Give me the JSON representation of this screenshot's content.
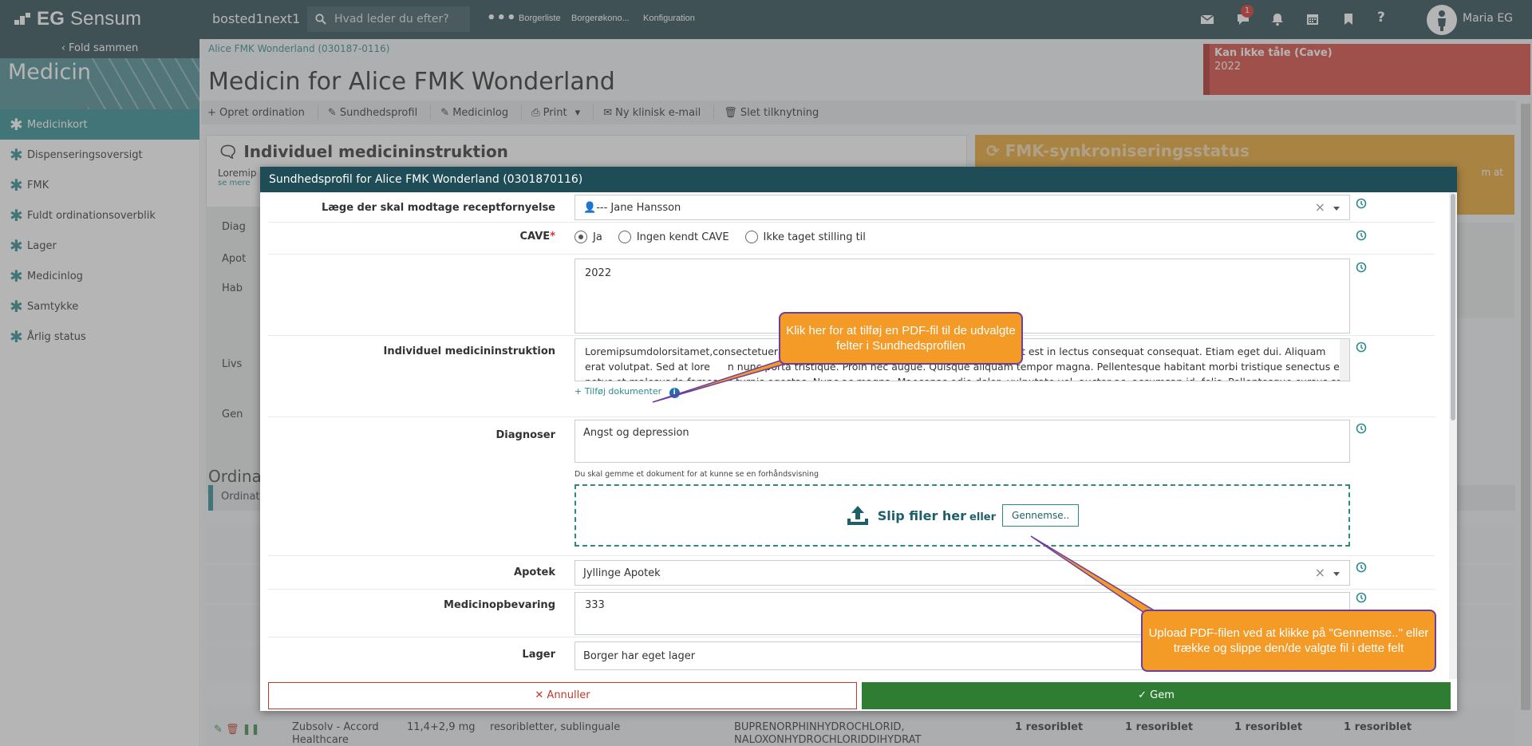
{
  "app": {
    "logo_prefix": "EG",
    "logo_suffix": "Sensum",
    "site": "bosted1next1"
  },
  "search": {
    "placeholder": "Hvad leder du efter?"
  },
  "topnav": [
    "Borgerliste",
    "Borgerøkono...",
    "Konfiguration"
  ],
  "notifications": {
    "count": "1"
  },
  "user": {
    "name": "Maria EG"
  },
  "sidebar": {
    "fold_label": "Fold sammen",
    "title": "Medicin",
    "items": [
      {
        "label": "Medicinkort",
        "active": true
      },
      {
        "label": "Dispenseringsoversigt"
      },
      {
        "label": "FMK"
      },
      {
        "label": "Fuldt ordinationsoverblik"
      },
      {
        "label": "Lager"
      },
      {
        "label": "Medicinlog"
      },
      {
        "label": "Samtykke"
      },
      {
        "label": "Årlig status"
      }
    ]
  },
  "page": {
    "breadcrumb": "Alice FMK Wonderland (030187-0116)",
    "title": "Medicin for Alice FMK Wonderland",
    "cave_banner": {
      "title": "Kan ikke tåle (Cave)",
      "text": "2022"
    }
  },
  "toolbar": [
    "Opret ordination",
    "Sundhedsprofil",
    "Medicinlog",
    "Print",
    "Ny klinisk e-mail",
    "Slet tilknytning"
  ],
  "cards": {
    "left_title": "Individuel medicininstruktion",
    "left_text": "Loremip",
    "left_more": "se mere",
    "right_title": "FMK-synkroniseringsstatus",
    "right_text": "m at"
  },
  "background_labels": [
    "Diag",
    "Apot",
    "Hab",
    "Livs",
    "Gen"
  ],
  "orders": {
    "title": "Ordinat",
    "tab": "Ordinat",
    "last_row": {
      "name": "Zubsolv - Accord Healthcare",
      "dose": "11,4+2,9 mg",
      "form": "resoribletter, sublinguale",
      "substance": "BUPRENORPHINHYDROCHLORID, NALOXONHYDROCHLORIDDIHYDRAT",
      "qty": [
        "1 resoriblet",
        "1 resoriblet",
        "1 resoriblet",
        "1 resoriblet"
      ]
    }
  },
  "modal": {
    "title": "Sundhedsprofil for Alice FMK Wonderland (0301870116)",
    "doctor": {
      "label": "Læge der skal modtage receptfornyelse",
      "value": "--- Jane Hansson"
    },
    "cave": {
      "label": "CAVE",
      "required": "*",
      "options": [
        "Ja",
        "Ingen kendt CAVE",
        "Ikke taget stilling til"
      ],
      "selected": "Ja",
      "text": "2022"
    },
    "instruction": {
      "label": "Individuel medicininstruktion",
      "line1": "Loremipsumdolorsitamet,consectetueradip",
      "line1b": "ut est in lectus consequat consequat. Etiam eget dui. Aliquam",
      "line2a": "erat volutpat. Sed at lore",
      "line2b": "n nunc porta tristique. Proin nec augue. Quisque aliquam tempor magna. Pellentesque habitant morbi tristique senectus et",
      "line3": "netus et malesuada fames ac turpis egestas. Nunc ac magna. Maecenas odio dolor, vulputate vel, auctor ac, accumsan id, felis. Pellentesque cursus sagittis",
      "add_doc": "Tilføj dokumenter"
    },
    "diagnoses": {
      "label": "Diagnoser",
      "value": "Angst og depression",
      "hint": "Du skal gemme et dokument for at kunne se en forhåndsvisning"
    },
    "dropzone": {
      "text": "Slip filer her",
      "or": "eller",
      "browse": "Gennemse.."
    },
    "pharmacy": {
      "label": "Apotek",
      "value": "Jyllinge Apotek"
    },
    "storage": {
      "label": "Medicinopbevaring",
      "value": "333"
    },
    "stock": {
      "label": "Lager",
      "value": "Borger har eget lager"
    },
    "cancel": "Annuller",
    "save": "Gem"
  },
  "callouts": {
    "top": "Klik her for at tilføj en PDF-fil til de udvalgte felter i Sundhedsprofilen",
    "bottom": "Upload PDF-filen ved at klikke på \"Gennemse..\" eller trække og slippe den/de valgte fil i dette felt"
  },
  "colors": {
    "topbar": "#2b4a52",
    "accent": "#2f8a8e",
    "cave": "#d9473c",
    "fmk": "#e8a52e",
    "save": "#2e7d32",
    "callout": "#f39a27"
  }
}
